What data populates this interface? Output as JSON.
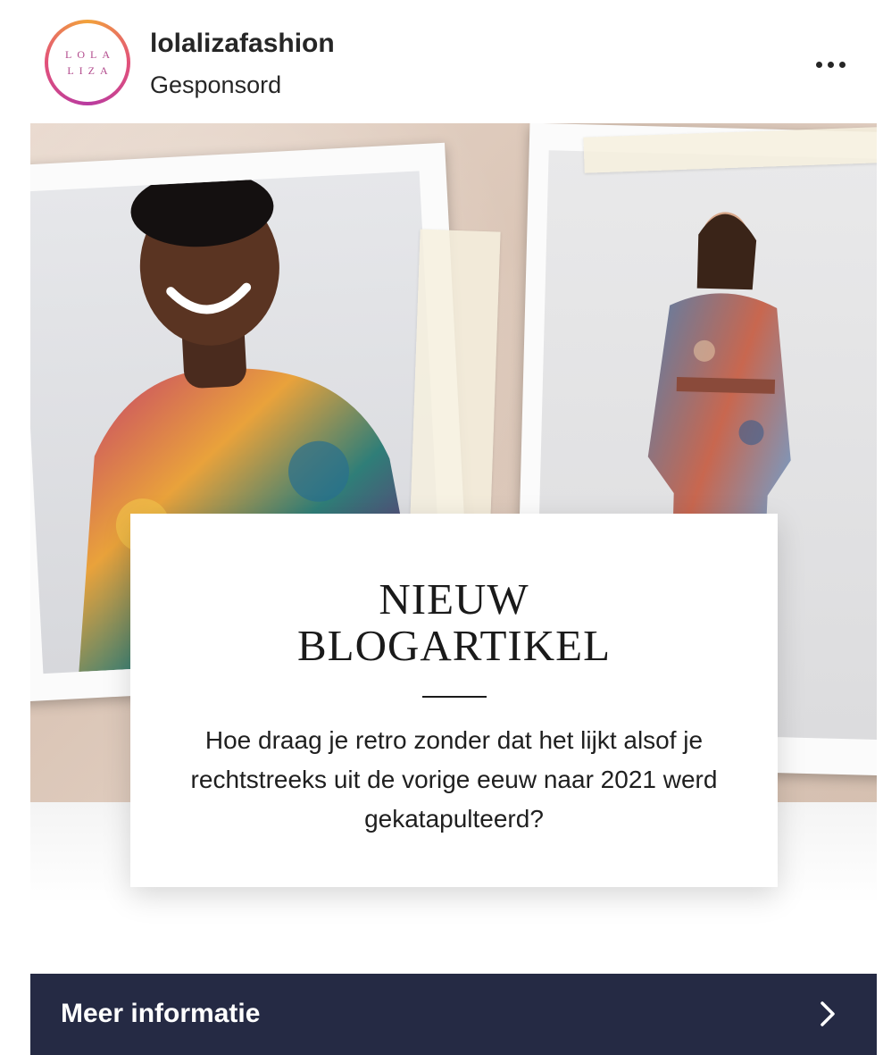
{
  "post": {
    "avatar": {
      "line1": "LOLA",
      "line2": "LIZA"
    },
    "username": "lolalizafashion",
    "sponsored_label": "Gesponsord",
    "more_icon": "more-horizontal-icon"
  },
  "ad": {
    "headline_line1": "NIEUW",
    "headline_line2": "BLOGARTIKEL",
    "body": "Hoe draag je retro zonder dat het lijkt alsof je rechtstreeks uit de vorige eeuw naar 2021 werd gekatapulteerd?"
  },
  "cta": {
    "label": "Meer informatie",
    "icon": "chevron-right-icon",
    "background": "#252a44"
  }
}
